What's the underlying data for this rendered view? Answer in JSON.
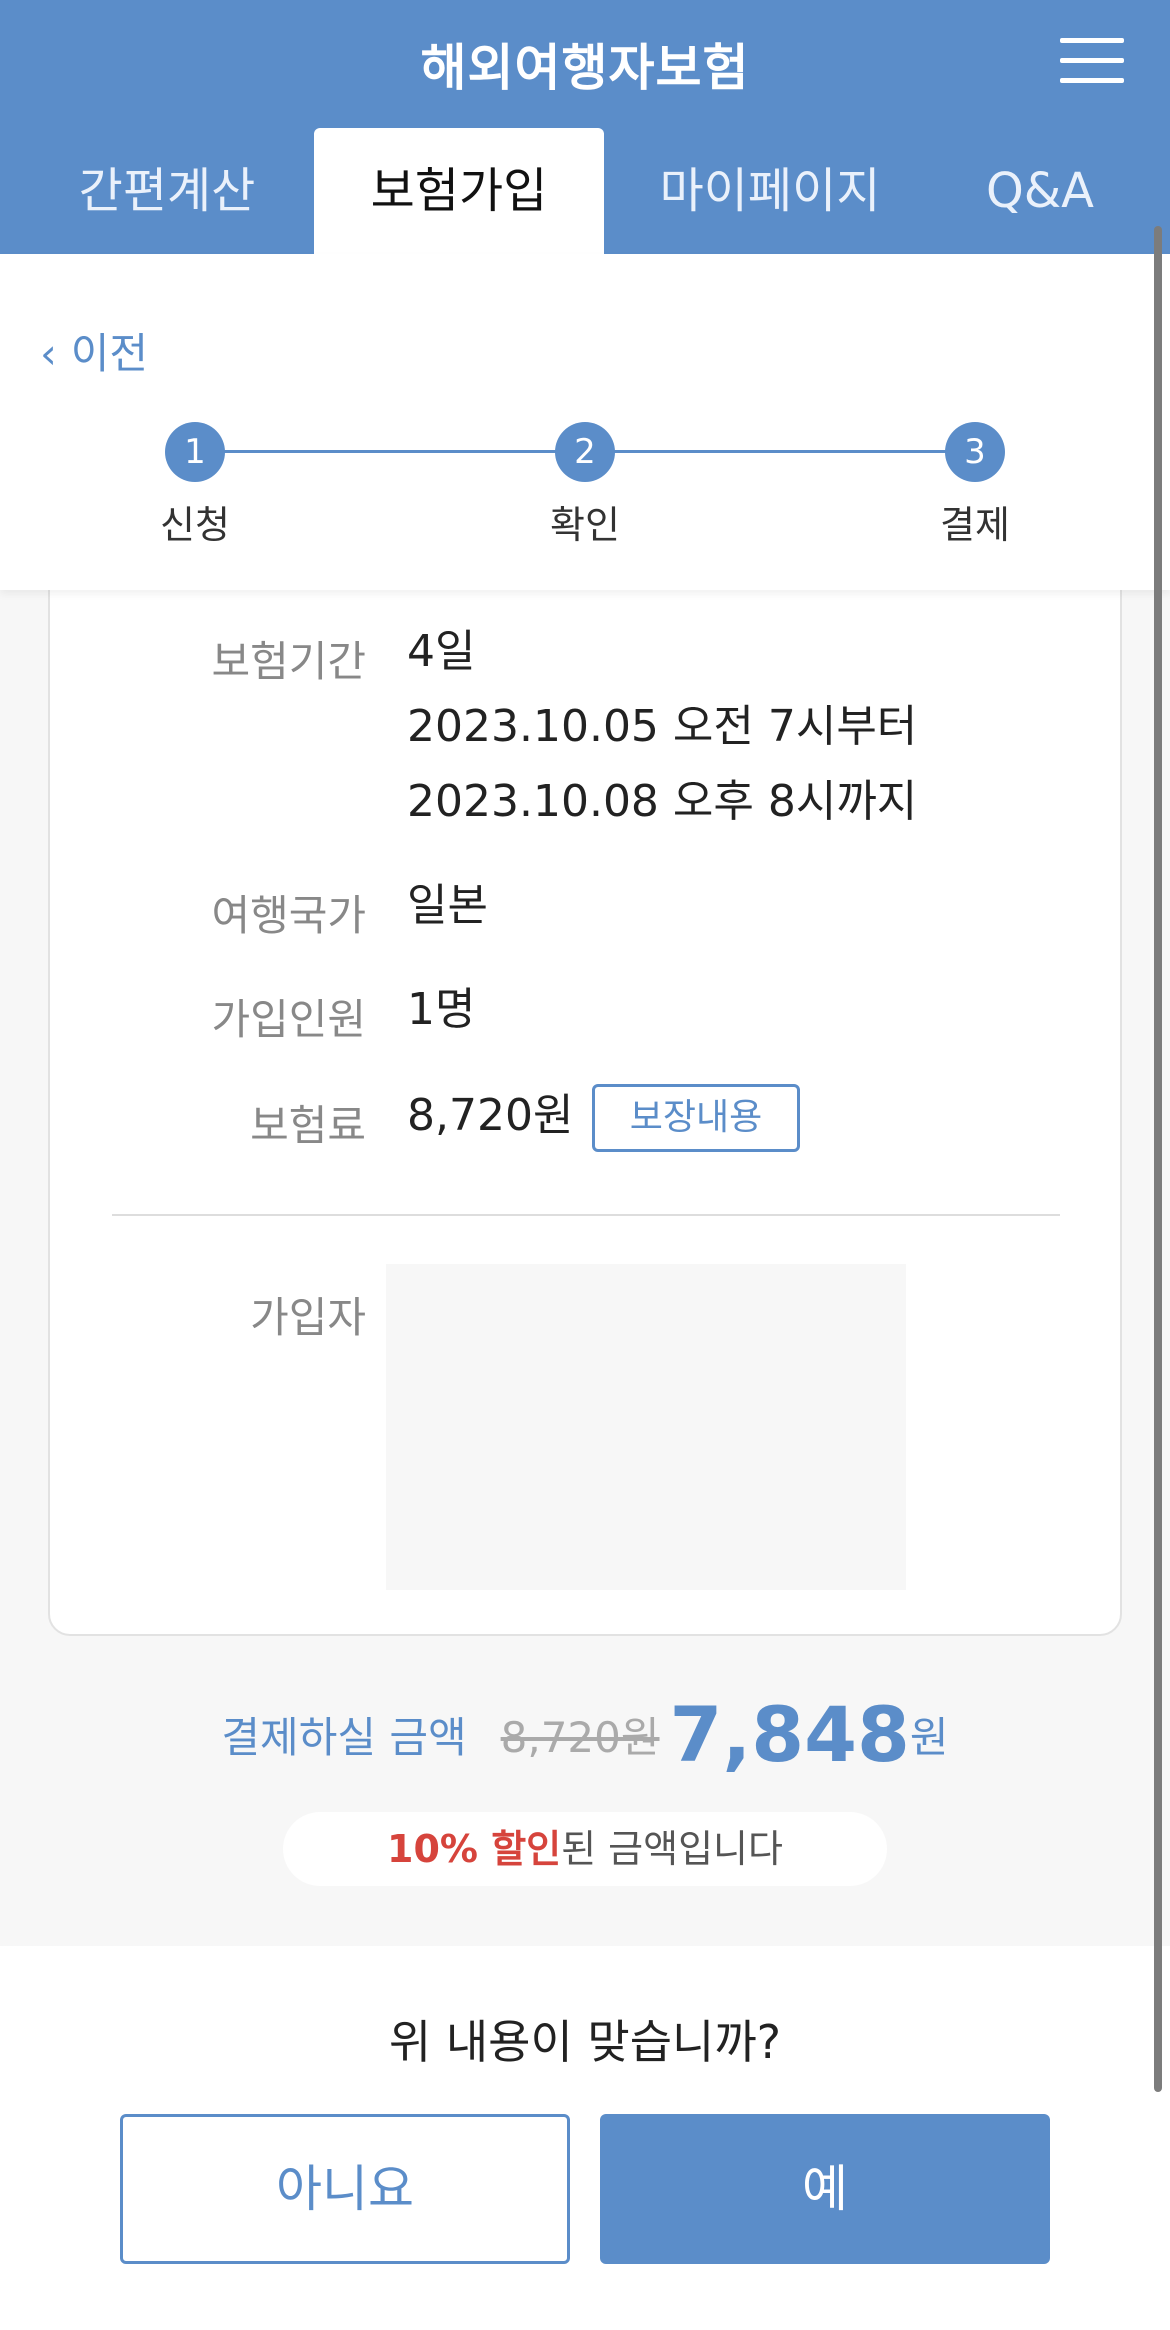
{
  "header": {
    "title": "해외여행자보험",
    "tabs": [
      {
        "label": "간편계산"
      },
      {
        "label": "보험가입"
      },
      {
        "label": "마이페이지"
      },
      {
        "label": "Q&A"
      }
    ],
    "active_tab": 1
  },
  "nav": {
    "back_label": "이전"
  },
  "steps": [
    {
      "number": "1",
      "label": "신청"
    },
    {
      "number": "2",
      "label": "확인"
    },
    {
      "number": "3",
      "label": "결제"
    }
  ],
  "details": {
    "period_label": "보험기간",
    "period_days": "4일",
    "period_start": "2023.10.05 오전 7시부터",
    "period_end": "2023.10.08 오후 8시까지",
    "country_label": "여행국가",
    "country_value": "일본",
    "people_label": "가입인원",
    "people_value": "1명",
    "premium_label": "보험료",
    "premium_value": "8,720원",
    "coverage_button": "보장내용",
    "applicant_label": "가입자"
  },
  "payment": {
    "label": "결제하실 금액",
    "original": "8,720원",
    "final_amount": "7,848",
    "final_unit": "원",
    "discount_highlight": "10% 할인",
    "discount_rest": "된 금액입니다"
  },
  "confirm": {
    "question": "위 내용이 맞습니까?",
    "no_label": "아니요",
    "yes_label": "예"
  },
  "colors": {
    "primary": "#5b8dc9",
    "discount": "#d6443c",
    "background": "#f7f7f7"
  }
}
